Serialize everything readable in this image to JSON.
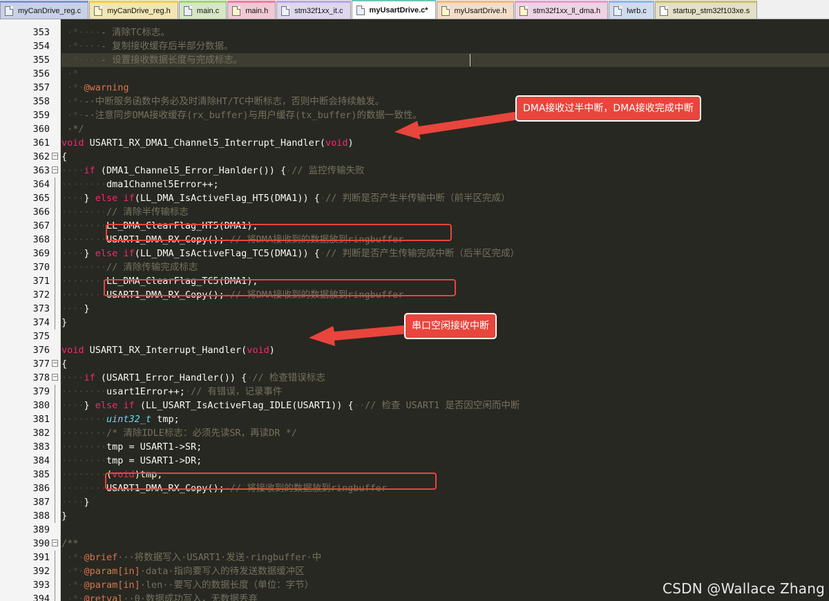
{
  "tabs": [
    {
      "label": "myCanDrive_reg.c",
      "type": "c",
      "color": "#7c93d8",
      "active": false
    },
    {
      "label": "myCanDrive_reg.h",
      "type": "h",
      "color": "#f2cf3a",
      "active": false
    },
    {
      "label": "main.c",
      "type": "c",
      "color": "#9fd470",
      "active": false
    },
    {
      "label": "main.h",
      "type": "h",
      "color": "#f07aa0",
      "active": false
    },
    {
      "label": "stm32f1xx_it.c",
      "type": "c",
      "color": "#b9a5e6",
      "active": false
    },
    {
      "label": "myUsartDrive.c*",
      "type": "c",
      "color": "#6ec6b8",
      "active": true
    },
    {
      "label": "myUsartDrive.h",
      "type": "h",
      "color": "#f5b77b",
      "active": false
    },
    {
      "label": "stm32f1xx_ll_dma.h",
      "type": "h",
      "color": "#e99acb",
      "active": false
    },
    {
      "label": "lwrb.c",
      "type": "c",
      "color": "#8fb5ea",
      "active": false
    },
    {
      "label": "startup_stm32f103xe.s",
      "type": "s",
      "color": "#c8c070",
      "active": false
    }
  ],
  "editor": {
    "lines": [
      {
        "n": "353",
        "segs": [
          [
            " ·*····",
            "ws"
          ],
          [
            "- 清除TC标志。",
            "cm"
          ]
        ]
      },
      {
        "n": "354",
        "segs": [
          [
            " ·*····",
            "ws"
          ],
          [
            "- 复制接收缓存后半部分数据。",
            "cm"
          ]
        ]
      },
      {
        "n": "355",
        "segs": [
          [
            " ·*····",
            "ws"
          ],
          [
            "- 设置接收数据长度与完成标志。",
            "cm"
          ]
        ]
      },
      {
        "n": "356",
        "segs": [
          [
            " ·*",
            "ws"
          ]
        ]
      },
      {
        "n": "357",
        "segs": [
          [
            " ·*·",
            "ws"
          ],
          [
            "@warning",
            "tag"
          ]
        ]
      },
      {
        "n": "358",
        "segs": [
          [
            " ·*·",
            "ws"
          ],
          [
            "-·中断服务函数中务必及时清除HT/TC中断标志，否则中断会持续触发。",
            "cm"
          ]
        ]
      },
      {
        "n": "359",
        "segs": [
          [
            " ·*·",
            "ws"
          ],
          [
            "-·注意同步DMA接收缓存(rx_buffer)与用户缓存(tx_buffer)的数据一致性。",
            "cm"
          ]
        ]
      },
      {
        "n": "360",
        "segs": [
          [
            " ·*/",
            "cm"
          ]
        ]
      },
      {
        "n": "361",
        "segs": [
          [
            "void",
            "kw"
          ],
          [
            " USART1_RX_DMA1_Channel5_Interrupt_Handler(",
            "pl"
          ],
          [
            "void",
            "kw"
          ],
          [
            ")",
            "pl"
          ]
        ]
      },
      {
        "n": "362",
        "segs": [
          [
            "{",
            "pl"
          ]
        ]
      },
      {
        "n": "363",
        "segs": [
          [
            "····",
            "ws"
          ],
          [
            "if",
            "kw"
          ],
          [
            " (DMA1_Channel5_Error_Hanlder()) {",
            "pl"
          ],
          [
            "·",
            "ws"
          ],
          [
            "// 监控传输失败",
            "cm"
          ]
        ]
      },
      {
        "n": "364",
        "segs": [
          [
            "········",
            "ws"
          ],
          [
            "dma1Channel5Error++;",
            "pl"
          ]
        ]
      },
      {
        "n": "365",
        "segs": [
          [
            "····",
            "ws"
          ],
          [
            "} ",
            "pl"
          ],
          [
            "else",
            "kw"
          ],
          [
            " ",
            "pl"
          ],
          [
            "if",
            "kw"
          ],
          [
            "(LL_DMA_IsActiveFlag_HT5(DMA1)) {",
            "pl"
          ],
          [
            "·",
            "ws"
          ],
          [
            "// 判断是否产生半传输中断（前半区完成）",
            "cm"
          ]
        ]
      },
      {
        "n": "366",
        "segs": [
          [
            "········",
            "ws"
          ],
          [
            "// 清除半传输标志",
            "cm"
          ]
        ]
      },
      {
        "n": "367",
        "segs": [
          [
            "········",
            "ws"
          ],
          [
            "LL_DMA_ClearFlag_HT5(DMA1);",
            "pl"
          ]
        ]
      },
      {
        "n": "368",
        "segs": [
          [
            "········",
            "ws"
          ],
          [
            "USART1_DMA_RX_Copy();",
            "pl"
          ],
          [
            "·",
            "ws"
          ],
          [
            "// 将DMA接收到的数据放到ringbuffer",
            "cm"
          ]
        ]
      },
      {
        "n": "369",
        "segs": [
          [
            "····",
            "ws"
          ],
          [
            "} ",
            "pl"
          ],
          [
            "else",
            "kw"
          ],
          [
            " ",
            "pl"
          ],
          [
            "if",
            "kw"
          ],
          [
            "(LL_DMA_IsActiveFlag_TC5(DMA1)) {",
            "pl"
          ],
          [
            "·",
            "ws"
          ],
          [
            "// 判断是否产生传输完成中断（后半区完成）",
            "cm"
          ]
        ]
      },
      {
        "n": "370",
        "segs": [
          [
            "········",
            "ws"
          ],
          [
            "// 清除传输完成标志",
            "cm"
          ]
        ]
      },
      {
        "n": "371",
        "segs": [
          [
            "········",
            "ws"
          ],
          [
            "LL_DMA_ClearFlag_TC5(DMA1);",
            "pl"
          ]
        ]
      },
      {
        "n": "372",
        "segs": [
          [
            "········",
            "ws"
          ],
          [
            "USART1_DMA_RX_Copy();",
            "pl"
          ],
          [
            "·",
            "ws"
          ],
          [
            "// 将DMA接收到的数据放到ringbuffer",
            "cm"
          ]
        ]
      },
      {
        "n": "373",
        "segs": [
          [
            "····",
            "ws"
          ],
          [
            "}",
            "pl"
          ]
        ]
      },
      {
        "n": "374",
        "segs": [
          [
            "}",
            "pl"
          ]
        ]
      },
      {
        "n": "375",
        "segs": []
      },
      {
        "n": "376",
        "segs": [
          [
            "void",
            "kw"
          ],
          [
            " USART1_RX_Interrupt_Handler(",
            "pl"
          ],
          [
            "void",
            "kw"
          ],
          [
            ")",
            "pl"
          ]
        ]
      },
      {
        "n": "377",
        "segs": [
          [
            "{",
            "pl"
          ]
        ]
      },
      {
        "n": "378",
        "segs": [
          [
            "····",
            "ws"
          ],
          [
            "if",
            "kw"
          ],
          [
            " (USART1_Error_Handler()) {",
            "pl"
          ],
          [
            "·",
            "ws"
          ],
          [
            "// 检查错误标志",
            "cm"
          ]
        ]
      },
      {
        "n": "379",
        "segs": [
          [
            "········",
            "ws"
          ],
          [
            "usart1Error++;",
            "pl"
          ],
          [
            "·",
            "ws"
          ],
          [
            "// 有错误，记录事件",
            "cm"
          ]
        ]
      },
      {
        "n": "380",
        "segs": [
          [
            "····",
            "ws"
          ],
          [
            "} ",
            "pl"
          ],
          [
            "else",
            "kw"
          ],
          [
            " ",
            "pl"
          ],
          [
            "if",
            "kw"
          ],
          [
            " (LL_USART_IsActiveFlag_IDLE(USART1)) {",
            "pl"
          ],
          [
            "··",
            "ws"
          ],
          [
            "// 检查 USART1 是否因空闲而中断",
            "cm"
          ]
        ]
      },
      {
        "n": "381",
        "segs": [
          [
            "········",
            "ws"
          ],
          [
            "uint32_t",
            "ty"
          ],
          [
            " tmp;",
            "pl"
          ]
        ]
      },
      {
        "n": "382",
        "segs": [
          [
            "········",
            "ws"
          ],
          [
            "/* 清除IDLE标志：必须先读SR，再读DR */",
            "cm"
          ]
        ]
      },
      {
        "n": "383",
        "segs": [
          [
            "········",
            "ws"
          ],
          [
            "tmp = USART1->SR;",
            "pl"
          ]
        ]
      },
      {
        "n": "384",
        "segs": [
          [
            "········",
            "ws"
          ],
          [
            "tmp = USART1->DR;",
            "pl"
          ]
        ]
      },
      {
        "n": "385",
        "segs": [
          [
            "········",
            "ws"
          ],
          [
            "(",
            "pl"
          ],
          [
            "void",
            "kw"
          ],
          [
            ")tmp;",
            "pl"
          ]
        ]
      },
      {
        "n": "386",
        "segs": [
          [
            "········",
            "ws"
          ],
          [
            "USART1_DMA_RX_Copy();",
            "pl"
          ],
          [
            "·",
            "ws"
          ],
          [
            "// 将接收到的数据放到ringbuffer",
            "cm"
          ]
        ]
      },
      {
        "n": "387",
        "segs": [
          [
            "····",
            "ws"
          ],
          [
            "}",
            "pl"
          ]
        ]
      },
      {
        "n": "388",
        "segs": [
          [
            "}",
            "pl"
          ]
        ]
      },
      {
        "n": "389",
        "segs": []
      },
      {
        "n": "390",
        "segs": [
          [
            "/**",
            "cm"
          ]
        ]
      },
      {
        "n": "391",
        "segs": [
          [
            " ·*·",
            "ws"
          ],
          [
            "@brief",
            "tag"
          ],
          [
            "···将数据写入·USART1·发送·ringbuffer·中",
            "cm"
          ]
        ]
      },
      {
        "n": "392",
        "segs": [
          [
            " ·*·",
            "ws"
          ],
          [
            "@param[in]",
            "tag"
          ],
          [
            "·data·指向要写入的待发送数据缓冲区",
            "cm"
          ]
        ]
      },
      {
        "n": "393",
        "segs": [
          [
            " ·*·",
            "ws"
          ],
          [
            "@param[in]",
            "tag"
          ],
          [
            "·len··要写入的数据长度（单位：字节）",
            "cm"
          ]
        ]
      },
      {
        "n": "394",
        "segs": [
          [
            " ·*·",
            "ws"
          ],
          [
            "@retval",
            "tag"
          ],
          [
            "··0·数据成功写入，无数据丢弃",
            "cm"
          ]
        ]
      }
    ]
  },
  "annotations": {
    "dma_label": "DMA接收过半中断，DMA接收完成中断",
    "idle_label": "串口空闲接收中断",
    "accent": "#e8453c"
  },
  "watermark": "CSDN @Wallace Zhang"
}
